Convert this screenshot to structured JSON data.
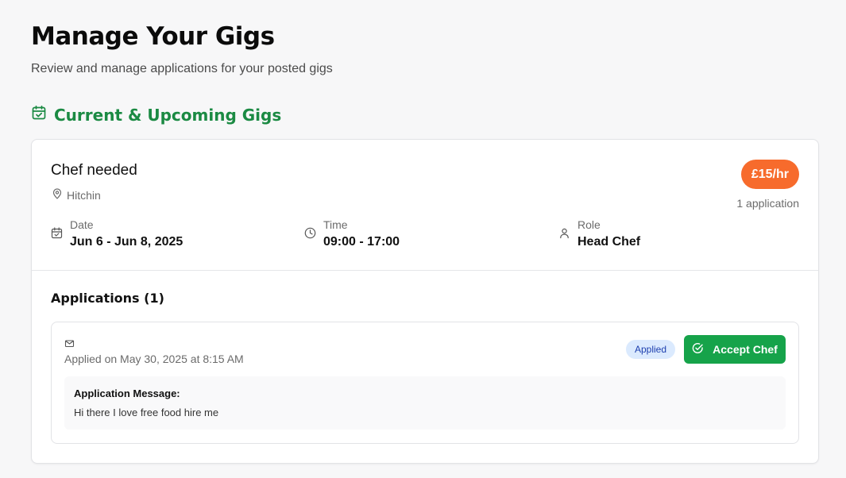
{
  "page": {
    "title": "Manage Your Gigs",
    "subtitle": "Review and manage applications for your posted gigs"
  },
  "section": {
    "title": "Current & Upcoming Gigs",
    "icon": "calendar-check-icon"
  },
  "gig": {
    "title": "Chef needed",
    "location": "Hitchin",
    "rate": "£15/hr",
    "application_count": "1 application",
    "details": {
      "date": {
        "label": "Date",
        "value": "Jun 6 - Jun 8, 2025",
        "icon": "calendar-icon"
      },
      "time": {
        "label": "Time",
        "value": "09:00 - 17:00",
        "icon": "clock-icon"
      },
      "role": {
        "label": "Role",
        "value": "Head Chef",
        "icon": "user-icon"
      }
    }
  },
  "applications": {
    "heading": "Applications (1)",
    "items": [
      {
        "applied_on": "Applied on May 30, 2025 at 8:15 AM",
        "status": "Applied",
        "accept_label": "Accept Chef",
        "message_label": "Application Message:",
        "message": "Hi there I love free food hire me"
      }
    ]
  },
  "colors": {
    "accent_green": "#1b8a43",
    "button_green": "#16a34a",
    "rate_orange": "#f76b2c",
    "status_blue_bg": "#dbeafe",
    "status_blue_text": "#1e40af"
  }
}
